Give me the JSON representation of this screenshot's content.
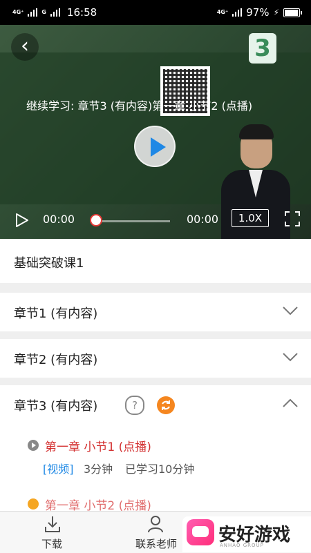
{
  "status_bar": {
    "left_network": "4G⁺",
    "left_network2": "G",
    "time": "16:58",
    "right_network": "4G⁺",
    "battery_percent": "97%",
    "battery_level": 0.97
  },
  "video": {
    "title": "继续学习: 章节3 (有内容)第一章 小节2 (点播)",
    "current_time": "00:00",
    "total_time": "00:00",
    "speed": "1.0X",
    "progress": 0
  },
  "course": {
    "title": "基础突破课1"
  },
  "chapters": [
    {
      "label": "章节1 (有内容)",
      "expanded": false
    },
    {
      "label": "章节2  (有内容)",
      "expanded": false
    },
    {
      "label": "章节3 (有内容)",
      "expanded": true
    }
  ],
  "chapter3": {
    "sections": [
      {
        "title": "第一章 小节1 (点播)",
        "tag": "[视频]",
        "duration": "3分钟",
        "learned": "已学习10分钟"
      },
      {
        "title": "第一章 小节2 (点播)"
      }
    ]
  },
  "bottom_bar": {
    "download_label": "下载",
    "contact_label": "联系老师"
  },
  "watermark": {
    "text": "安好游戏",
    "sub": "ANHAO GROUP"
  },
  "colors": {
    "accent_red": "#d32f2f",
    "accent_blue": "#1e88e5",
    "accent_orange": "#f5861f"
  }
}
